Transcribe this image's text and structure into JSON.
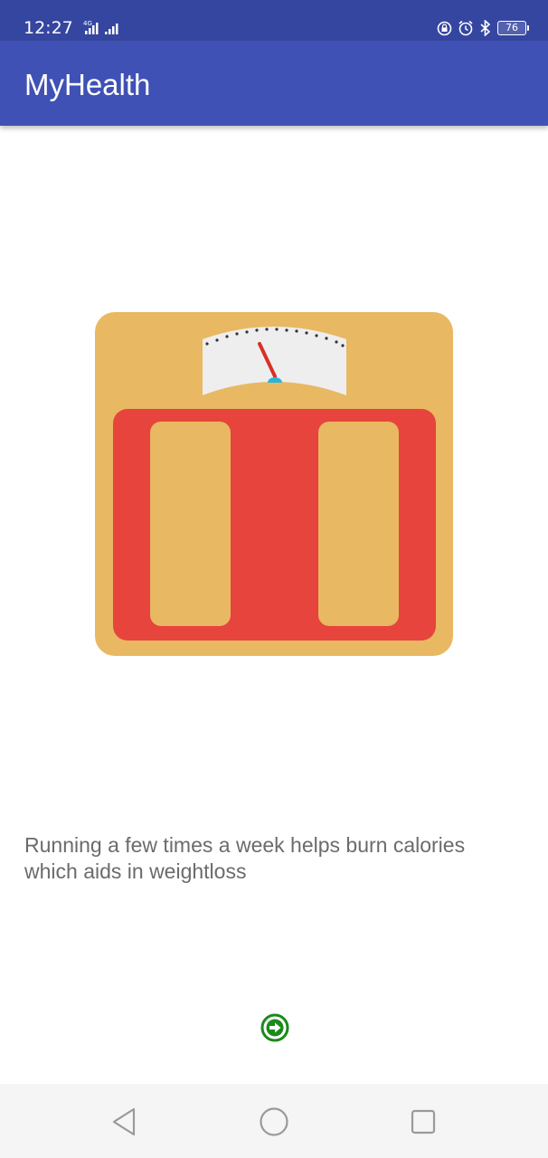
{
  "status_bar": {
    "time": "12:27",
    "network": "4G",
    "battery": "76",
    "icons": [
      "signal-icon",
      "lock-rotation-icon",
      "alarm-icon",
      "bluetooth-icon",
      "battery-icon"
    ]
  },
  "app_bar": {
    "title": "MyHealth"
  },
  "illustration": {
    "name": "weighing-scale",
    "colors": {
      "body": "#e8b862",
      "platform": "#e6443d",
      "dial": "#eeeeee",
      "needle": "#d93025",
      "pivot": "#29b6d6"
    }
  },
  "tip": {
    "text": "Running a few times a week helps burn calories which aids in weightloss"
  },
  "next_button": {
    "icon": "arrow-right-circle-icon",
    "color": "#1b8a1b"
  },
  "nav_bar": {
    "buttons": [
      "back-icon",
      "home-icon",
      "recents-icon"
    ]
  }
}
